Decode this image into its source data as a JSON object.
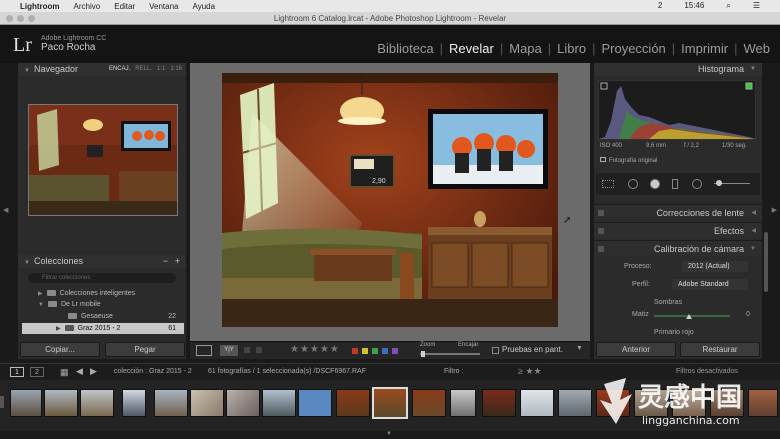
{
  "menubar": {
    "app": "Lightroom",
    "items": [
      "Archivo",
      "Editar",
      "Ventana",
      "Ayuda"
    ],
    "right_badge": "2",
    "clock": "15:46"
  },
  "window": {
    "title": "Lightroom 6 Catalog.lrcat - Adobe Photoshop Lightroom - Revelar"
  },
  "identity": {
    "logo": "Lr",
    "product": "Adobe Lightroom CC",
    "user": "Paco Rocha"
  },
  "modules": [
    {
      "label": "Biblioteca"
    },
    {
      "label": "Revelar"
    },
    {
      "label": "Mapa"
    },
    {
      "label": "Libro"
    },
    {
      "label": "Proyección"
    },
    {
      "label": "Imprimir"
    },
    {
      "label": "Web"
    }
  ],
  "active_module": "Revelar",
  "navigator": {
    "title": "Navegador",
    "options": [
      "ENCAJ.",
      "RELL.",
      "1:1",
      "1:16"
    ]
  },
  "collections": {
    "title": "Colecciones",
    "controls": [
      "−",
      "+"
    ],
    "search_placeholder": "Filtrar colecciones",
    "items": [
      {
        "label": "Colecciones inteligentes",
        "count": ""
      },
      {
        "label": "De Lr mobile",
        "count": ""
      },
      {
        "label": "Gesaeuse",
        "count": "22"
      },
      {
        "label": "Graz 2015 - 2",
        "count": "61"
      }
    ]
  },
  "left_buttons": {
    "copy": "Copiar...",
    "paste": "Pegar"
  },
  "toolbar": {
    "stars": "★★★★★",
    "zoom_label": "Zoom",
    "fit_label": "Encajar",
    "proof_label": "Pruebas en pant.",
    "flag_colors": [
      "#c0392b",
      "#d4c12a",
      "#3fa34d",
      "#3b6fc4",
      "#7e4fb8"
    ]
  },
  "histogram": {
    "title": "Histograma",
    "iso": "ISO 400",
    "focal": "9,6 mm",
    "aperture": "f / 2,2",
    "shutter": "1/30 seg.",
    "original_label": "Fotografía original"
  },
  "sections": {
    "lens": "Correcciones de lente",
    "effects": "Efectos",
    "calibration": "Calibración de cámara"
  },
  "calibration": {
    "process_label": "Proceso:",
    "process_value": "2012 (Actual)",
    "profile_label": "Perfil:",
    "profile_value": "Adobe Standard",
    "shadows_label": "Sombras",
    "tint_label": "Matiz",
    "tint_value": "0",
    "primary_red_label": "Primario rojo"
  },
  "right_buttons": {
    "previous": "Anterior",
    "reset": "Restaurar"
  },
  "filmbar": {
    "view1": "1",
    "view2": "2",
    "path": "colección : Graz 2015 - 2",
    "info": "61 fotografías / 1 seleccionada(s) /DSCF6967.RAF",
    "filter_label": "Filtro :",
    "filter_off": "Filtros desactivados"
  },
  "watermark": {
    "cn": "灵感中国",
    "url": "lingganchina.com"
  },
  "icons": [
    "apple-icon",
    "search-icon",
    "folder-icon",
    "triangle-icon",
    "grid-icon",
    "arrow-left-icon",
    "arrow-right-icon"
  ]
}
